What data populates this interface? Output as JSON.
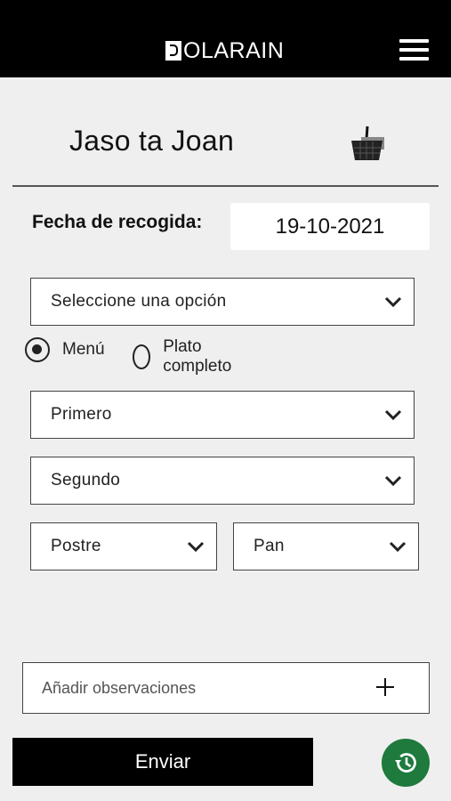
{
  "header": {
    "brand": "OLARAIN",
    "menu_icon": "hamburger-menu-icon"
  },
  "page": {
    "title": "Jaso ta Joan",
    "basket_icon": "basket-icon"
  },
  "pickup": {
    "label": "Fecha de recogida:",
    "date": "19-10-2021"
  },
  "form": {
    "option_select": "Seleccione una opción",
    "radio_options": [
      {
        "label": "Menú",
        "checked": true
      },
      {
        "label": "Plato completo",
        "checked": false
      }
    ],
    "first_course": "Primero",
    "second_course": "Segundo",
    "dessert": "Postre",
    "bread": "Pan"
  },
  "observations": {
    "placeholder": "Añadir observaciones",
    "add_icon": "plus-icon"
  },
  "actions": {
    "send_label": "Enviar",
    "history_icon": "history-icon",
    "history_color": "#1e7a3d"
  }
}
